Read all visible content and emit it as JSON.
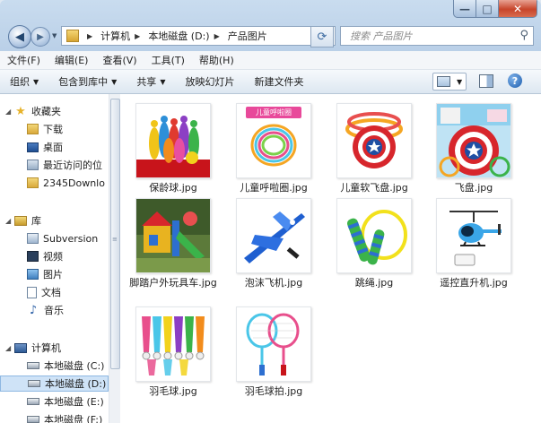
{
  "window": {
    "caption_buttons": {
      "minimize": "—",
      "maximize": "□",
      "close": "✕"
    }
  },
  "address": {
    "path": [
      "计算机",
      "本地磁盘 (D:)",
      "产品图片"
    ],
    "search_placeholder": "搜索 产品图片"
  },
  "menu": [
    "文件(F)",
    "编辑(E)",
    "查看(V)",
    "工具(T)",
    "帮助(H)"
  ],
  "commands": [
    {
      "label": "组织",
      "dropdown": true
    },
    {
      "label": "包含到库中",
      "dropdown": true
    },
    {
      "label": "共享",
      "dropdown": true
    },
    {
      "label": "放映幻灯片",
      "dropdown": false
    },
    {
      "label": "新建文件夹",
      "dropdown": false
    }
  ],
  "nav": {
    "favorites_label": "收藏夹",
    "favorites": [
      "下载",
      "桌面",
      "最近访问的位",
      "2345Downlo"
    ],
    "libraries_label": "库",
    "libraries": [
      "Subversion",
      "视频",
      "图片",
      "文档",
      "音乐"
    ],
    "computer_label": "计算机",
    "drives": [
      "本地磁盘 (C:)",
      "本地磁盘 (D:)",
      "本地磁盘 (E:)",
      "本地磁盘 (F:)"
    ],
    "selected_drive_index": 1
  },
  "files": [
    {
      "name": "保龄球.jpg",
      "thumb": "bowling-pins"
    },
    {
      "name": "儿童呼啦圈.jpg",
      "thumb": "hula-hoops",
      "thumb_text": "儿童呼啦圈"
    },
    {
      "name": "儿童软飞盘.jpg",
      "thumb": "soft-frisbee"
    },
    {
      "name": "飞盘.jpg",
      "thumb": "frisbee-shield"
    },
    {
      "name": "脚踏户外玩具车.jpg",
      "thumb": "outdoor-playset"
    },
    {
      "name": "泡沫飞机.jpg",
      "thumb": "foam-plane"
    },
    {
      "name": "跳绳.jpg",
      "thumb": "jump-rope"
    },
    {
      "name": "遥控直升机.jpg",
      "thumb": "rc-helicopter"
    },
    {
      "name": "羽毛球.jpg",
      "thumb": "shuttlecocks"
    },
    {
      "name": "羽毛球拍.jpg",
      "thumb": "badminton-rackets"
    }
  ]
}
